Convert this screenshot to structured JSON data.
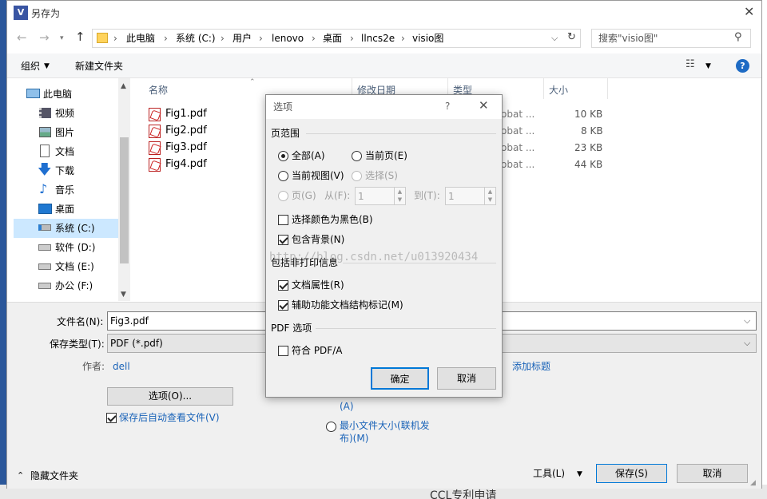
{
  "window": {
    "title": "另存为",
    "app_icon_text": "V"
  },
  "address": {
    "segments": [
      "此电脑",
      "系统 (C:)",
      "用户",
      "lenovo",
      "桌面",
      "llncs2e",
      "visio图"
    ],
    "search_placeholder": "搜索\"visio图\""
  },
  "toolbar": {
    "organize": "组织",
    "new_folder": "新建文件夹",
    "help": "?"
  },
  "sidebar": {
    "items": [
      {
        "label": "此电脑",
        "icon": "computer-icon"
      },
      {
        "label": "视频",
        "icon": "video-icon"
      },
      {
        "label": "图片",
        "icon": "pictures-icon"
      },
      {
        "label": "文档",
        "icon": "documents-icon"
      },
      {
        "label": "下载",
        "icon": "download-icon"
      },
      {
        "label": "音乐",
        "icon": "music-icon"
      },
      {
        "label": "桌面",
        "icon": "desktop-icon"
      },
      {
        "label": "系统 (C:)",
        "icon": "drive-icon"
      },
      {
        "label": "软件 (D:)",
        "icon": "drive-icon"
      },
      {
        "label": "文档 (E:)",
        "icon": "drive-icon"
      },
      {
        "label": "办公 (F:)",
        "icon": "drive-icon"
      }
    ]
  },
  "columns": {
    "name": "名称",
    "modified": "修改日期",
    "type": "类型",
    "size": "大小"
  },
  "files": [
    {
      "name": "Fig1.pdf",
      "type": "obat ...",
      "size": "10 KB"
    },
    {
      "name": "Fig2.pdf",
      "type": "obat ...",
      "size": "8 KB"
    },
    {
      "name": "Fig3.pdf",
      "type": "obat ...",
      "size": "23 KB"
    },
    {
      "name": "Fig4.pdf",
      "type": "obat ...",
      "size": "44 KB"
    }
  ],
  "form": {
    "filename_label": "文件名(N):",
    "filename_value": "Fig3.pdf",
    "type_label": "保存类型(T):",
    "type_value": "PDF (*.pdf)",
    "author_label": "作者:",
    "author_value": "dell",
    "tag_label": "添加标题",
    "options_btn": "选项(O)...",
    "autoview": "保存后自动查看文件(V)",
    "optimize_std_tail": "(A)",
    "optimize_min_line1": "最小文件大小(联机发",
    "optimize_min_line2": "布)(M)",
    "hide_folders": "隐藏文件夹",
    "tools": "工具(L)",
    "save": "保存(S)",
    "cancel": "取消"
  },
  "dialog": {
    "title": "选项",
    "help": "?",
    "range_header": "页范围",
    "all": "全部(A)",
    "current_page": "当前页(E)",
    "current_view": "当前视图(V)",
    "selection": "选择(S)",
    "pages": "页(G)",
    "from": "从(F):",
    "from_value": "1",
    "to": "到(T):",
    "to_value": "1",
    "black": "选择颜色为黑色(B)",
    "include_bg": "包含背景(N)",
    "nonprint_header": "包括非打印信息",
    "doc_props": "文档属性(R)",
    "access_tags": "辅助功能文档结构标记(M)",
    "pdf_header": "PDF 选项",
    "pdfa": "符合 PDF/A",
    "ok": "确定",
    "cancel": "取消"
  },
  "watermark": "http://blog.csdn.net/u013920434",
  "background_text": "CCL专利申请",
  "colors": {
    "accent": "#0078d7",
    "link": "#1a63b8",
    "selected": "#cce8ff",
    "panel": "#f0f0f0"
  }
}
